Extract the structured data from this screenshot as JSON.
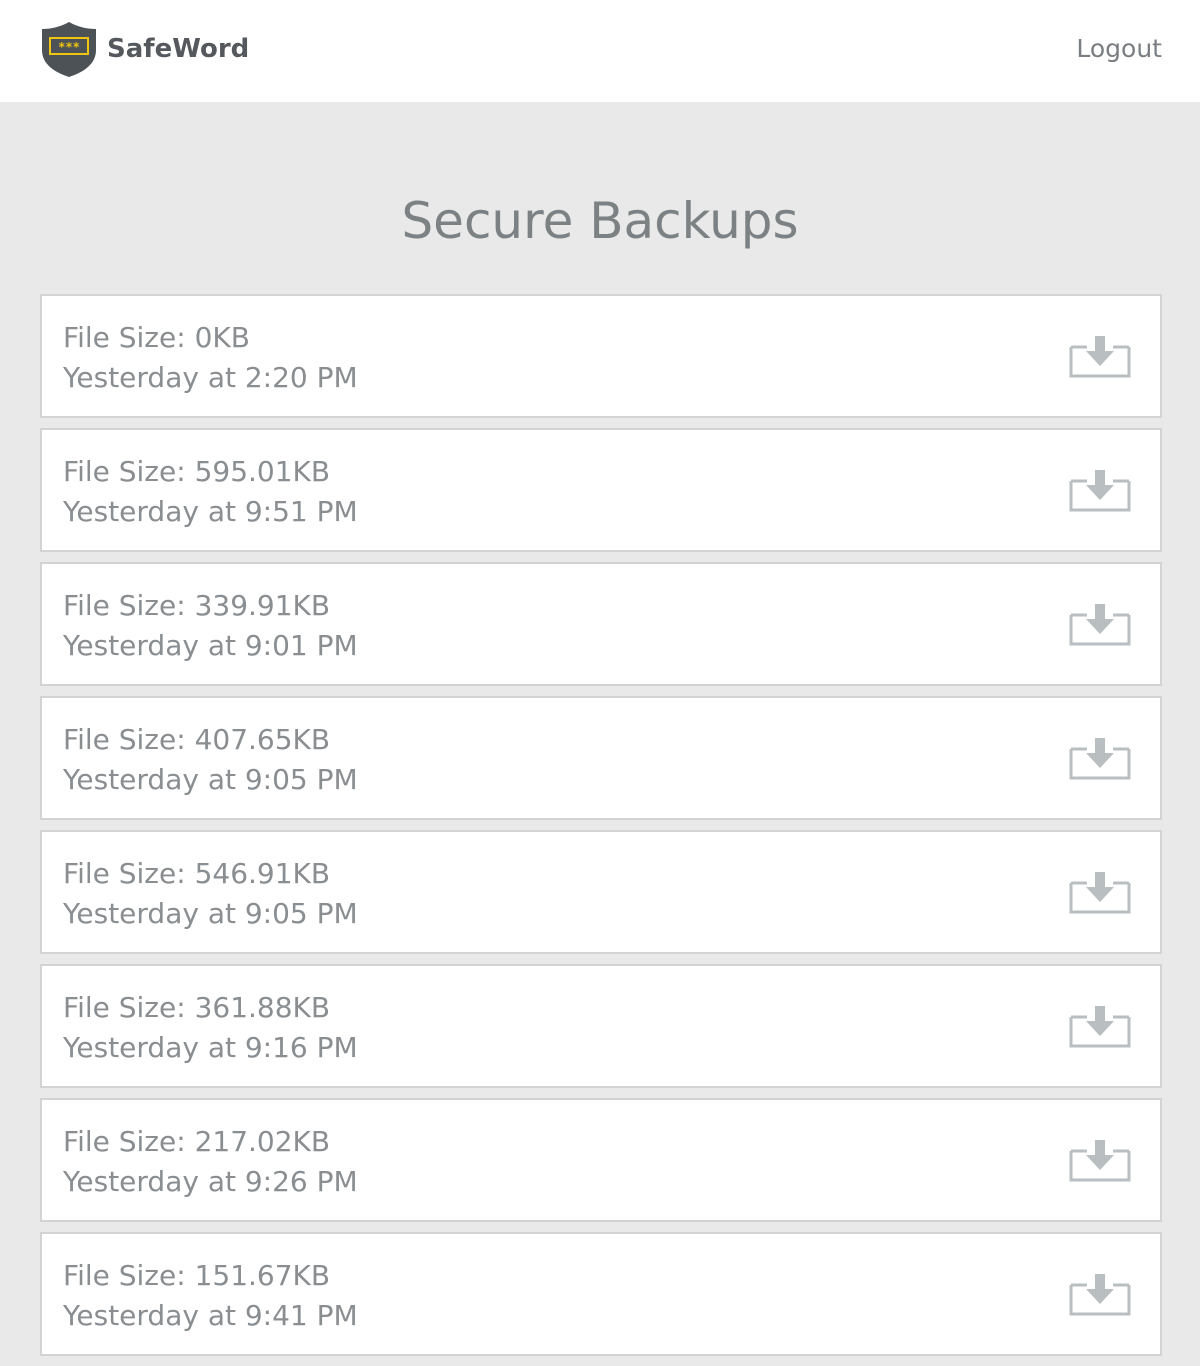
{
  "header": {
    "brand_name": "SafeWord",
    "logo_text": "***",
    "logout_label": "Logout"
  },
  "main": {
    "title": "Secure Backups",
    "backups": [
      {
        "size": "File Size: 0KB",
        "time": "Yesterday at 2:20 PM"
      },
      {
        "size": "File Size: 595.01KB",
        "time": "Yesterday at 9:51 PM"
      },
      {
        "size": "File Size: 339.91KB",
        "time": "Yesterday at 9:01 PM"
      },
      {
        "size": "File Size: 407.65KB",
        "time": "Yesterday at 9:05 PM"
      },
      {
        "size": "File Size: 546.91KB",
        "time": "Yesterday at 9:05 PM"
      },
      {
        "size": "File Size: 361.88KB",
        "time": "Yesterday at 9:16 PM"
      },
      {
        "size": "File Size: 217.02KB",
        "time": "Yesterday at 9:26 PM"
      },
      {
        "size": "File Size: 151.67KB",
        "time": "Yesterday at 9:41 PM"
      }
    ]
  },
  "icons": {
    "download": "download-icon",
    "logo": "shield-icon"
  },
  "colors": {
    "background": "#e8e9e8",
    "header": "#ffffff",
    "shield": "#4d5257",
    "logo_accent": "#f1c40f",
    "icon": "#b9bec0",
    "text": "#8a8e91"
  }
}
